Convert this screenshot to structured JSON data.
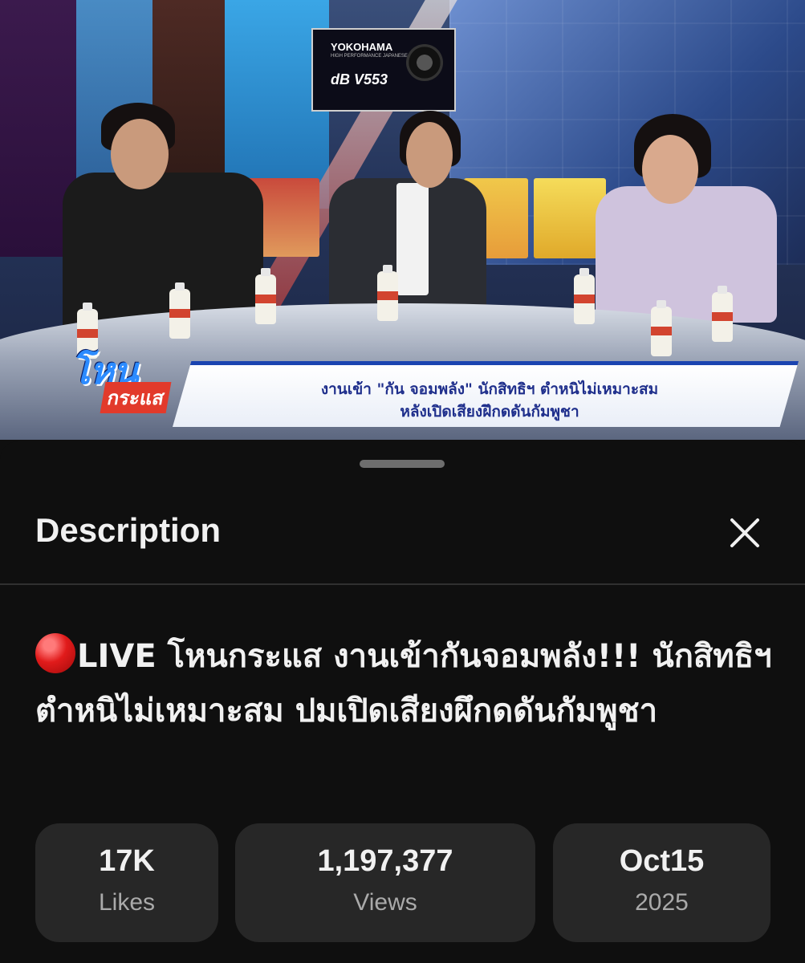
{
  "video": {
    "ad": {
      "brand": "YOKOHAMA",
      "tagline": "HIGH PERFORMANCE JAPANESE TIRE",
      "model": "dB V553"
    },
    "show_logo": {
      "top": "โหน",
      "bottom": "กระแส"
    },
    "ticker": {
      "line1": "งานเข้า \"กัน จอมพลัง\" นักสิทธิฯ ตำหนิไม่เหมาะสม",
      "line2": "หลังเปิดเสียงฝึกดดันกัมพูชา"
    },
    "colors": {
      "ticker_text": "#1f2f8c",
      "ticker_border": "#1b44b0"
    }
  },
  "sheet": {
    "title": "Description",
    "close_icon": "close-icon",
    "video_title": {
      "live_icon": "red-circle-icon",
      "text": "LIVE โหนกระแส งานเข้ากันจอมพลัง!!! นักสิทธิฯตำหนิไม่เหมาะสม ปมเปิดเสียงผึกดดันกัมพูชา"
    },
    "stats": [
      {
        "value": "17K",
        "label": "Likes"
      },
      {
        "value": "1,197,377",
        "label": "Views"
      },
      {
        "value": "Oct15",
        "label": "2025"
      }
    ],
    "colors": {
      "background": "#0f0f0f",
      "card": "#272727",
      "muted_text": "#aaaaaa",
      "live_red": "#e11b1b"
    }
  }
}
